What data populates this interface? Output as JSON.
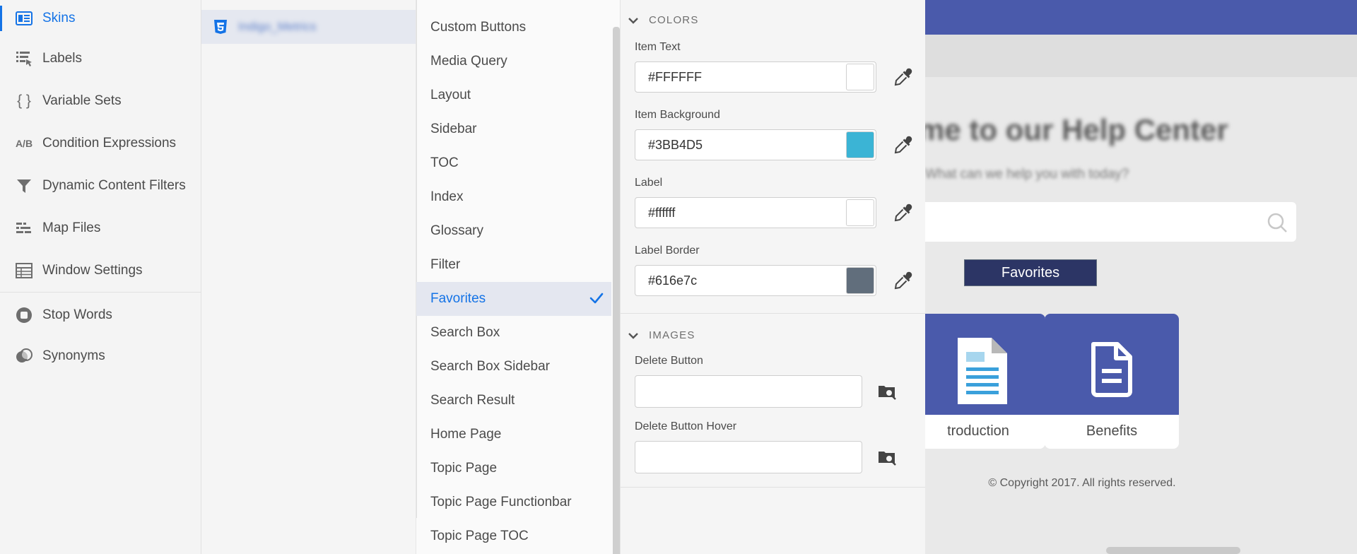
{
  "leftnav": {
    "items": [
      {
        "label": "Skins",
        "icon": "skins-icon",
        "active": true
      },
      {
        "label": "Labels",
        "icon": "labels-icon"
      },
      {
        "label": "Variable Sets",
        "icon": "braces-icon",
        "icon_text": "{ }"
      },
      {
        "label": "Condition Expressions",
        "icon": "ab-icon",
        "icon_text": "A/B"
      },
      {
        "label": "Dynamic Content Filters",
        "icon": "filter-icon"
      },
      {
        "label": "Map Files",
        "icon": "map-files-icon"
      },
      {
        "label": "Window Settings",
        "icon": "table-icon"
      },
      {
        "label": "Stop Words",
        "icon": "stop-icon"
      },
      {
        "label": "Synonyms",
        "icon": "synonyms-icon"
      }
    ]
  },
  "filelist": {
    "item_name": "Indigo_Metrics",
    "icon": "html5-icon"
  },
  "components": {
    "items": [
      {
        "label": "Custom Buttons"
      },
      {
        "label": "Media Query"
      },
      {
        "label": "Layout"
      },
      {
        "label": "Sidebar"
      },
      {
        "label": "TOC"
      },
      {
        "label": "Index"
      },
      {
        "label": "Glossary"
      },
      {
        "label": "Filter"
      },
      {
        "label": "Favorites",
        "selected": true
      },
      {
        "label": "Search Box"
      },
      {
        "label": "Search Box Sidebar"
      },
      {
        "label": "Search Result"
      },
      {
        "label": "Home Page"
      },
      {
        "label": "Topic Page"
      },
      {
        "label": "Topic Page Functionbar"
      },
      {
        "label": "Topic Page TOC"
      }
    ]
  },
  "properties": {
    "colors_title": "COLORS",
    "colors": [
      {
        "label": "Item Text",
        "value": "#FFFFFF",
        "swatch": "#FFFFFF"
      },
      {
        "label": "Item Background",
        "value": "#3BB4D5",
        "swatch": "#3BB4D5"
      },
      {
        "label": "Label",
        "value": "#ffffff",
        "swatch": "#ffffff"
      },
      {
        "label": "Label Border",
        "value": "#616e7c",
        "swatch": "#616e7c"
      }
    ],
    "images_title": "IMAGES",
    "images": [
      {
        "label": "Delete Button",
        "value": ""
      },
      {
        "label": "Delete Button Hover",
        "value": ""
      }
    ]
  },
  "preview": {
    "title": "me to our Help Center",
    "subtitle": "What can we help you with today?",
    "favorites_label": "Favorites",
    "tiles": [
      {
        "label": "troduction",
        "icon": "document-icon"
      },
      {
        "label": "Benefits",
        "icon": "file-icon"
      }
    ],
    "copyright": "© Copyright 2017. All rights reserved.",
    "header_color": "#4a5aab"
  }
}
